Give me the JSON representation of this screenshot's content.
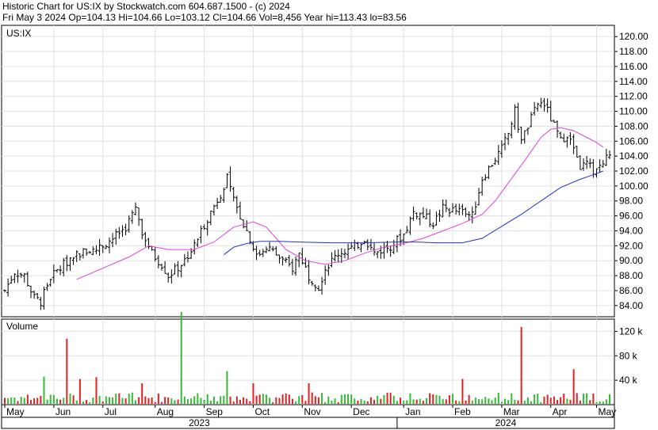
{
  "header": {
    "line1": "Historic Chart for US:IX by Stockwatch.com 604.687.1500 - (c) 2024",
    "line2": "Fri May  3 2024   Op=104.13   Hi=104.66   Lo=103.12   Cl=104.66   Vol=8,456   Year hi=113.43   lo=83.56"
  },
  "chart_data": {
    "type": "ohlc",
    "symbol_label": "US:IX",
    "volume_label": "Volume",
    "price_axis": {
      "ticks": [
        "120.00",
        "118.00",
        "116.00",
        "114.00",
        "112.00",
        "110.00",
        "108.00",
        "106.00",
        "104.00",
        "102.00",
        "100.00",
        "98.00",
        "96.00",
        "94.00",
        "92.00",
        "90.00",
        "88.00",
        "86.00",
        "84.00"
      ],
      "range": [
        82.5,
        121.5
      ]
    },
    "volume_axis": {
      "ticks": [
        "120 k",
        "80 k",
        "40 k"
      ],
      "range": [
        0,
        140000
      ]
    },
    "months": [
      "May",
      "Jun",
      "Jul",
      "Aug",
      "Sep",
      "Oct",
      "Nov",
      "Dec",
      "Jan",
      "Feb",
      "Mar",
      "Apr",
      "May"
    ],
    "years": [
      "2023",
      "2024"
    ],
    "price_anchors": [
      [
        0,
        86
      ],
      [
        3,
        88.5
      ],
      [
        6,
        88
      ],
      [
        9,
        85
      ],
      [
        11,
        84.5
      ],
      [
        14,
        87.8
      ],
      [
        18,
        89.5
      ],
      [
        22,
        91
      ],
      [
        28,
        91.5
      ],
      [
        33,
        93
      ],
      [
        37,
        94.5
      ],
      [
        40,
        97
      ],
      [
        42,
        94
      ],
      [
        45,
        91
      ],
      [
        48,
        89.5
      ],
      [
        50,
        88
      ],
      [
        54,
        89.5
      ],
      [
        58,
        92
      ],
      [
        60,
        94
      ],
      [
        63,
        96.5
      ],
      [
        66,
        99
      ],
      [
        68,
        101
      ],
      [
        70,
        98
      ],
      [
        72,
        96
      ],
      [
        75,
        93
      ],
      [
        77,
        90.5
      ],
      [
        80,
        92
      ],
      [
        85,
        90
      ],
      [
        88,
        89
      ],
      [
        90,
        91
      ],
      [
        93,
        88
      ],
      [
        96,
        86.5
      ],
      [
        98,
        89
      ],
      [
        102,
        91
      ],
      [
        107,
        91.8
      ],
      [
        110,
        93
      ],
      [
        113,
        91
      ],
      [
        118,
        92
      ],
      [
        122,
        93.5
      ],
      [
        125,
        96.5
      ],
      [
        128,
        96
      ],
      [
        131,
        95
      ],
      [
        134,
        97
      ],
      [
        140,
        96.5
      ],
      [
        143,
        96
      ],
      [
        146,
        101
      ],
      [
        149,
        103
      ],
      [
        152,
        105
      ],
      [
        154,
        107
      ],
      [
        156,
        110
      ],
      [
        158,
        106
      ],
      [
        160,
        108
      ],
      [
        163,
        111
      ],
      [
        165,
        111
      ],
      [
        167,
        109
      ],
      [
        170,
        106
      ],
      [
        172,
        107
      ],
      [
        174,
        105
      ],
      [
        176,
        102.5
      ],
      [
        178,
        103
      ],
      [
        180,
        102
      ],
      [
        183,
        103
      ],
      [
        185,
        104.5
      ]
    ],
    "volume_spikes": [
      [
        12,
        46000
      ],
      [
        19,
        108000
      ],
      [
        23,
        42000
      ],
      [
        28,
        45000
      ],
      [
        42,
        35000
      ],
      [
        54,
        152000
      ],
      [
        68,
        55000
      ],
      [
        76,
        35000
      ],
      [
        93,
        35000
      ],
      [
        140,
        42000
      ],
      [
        158,
        127000
      ],
      [
        174,
        58000
      ]
    ],
    "ma_short": [
      [
        22,
        87.5
      ],
      [
        30,
        89
      ],
      [
        38,
        90.5
      ],
      [
        44,
        92
      ],
      [
        50,
        91.5
      ],
      [
        58,
        91.5
      ],
      [
        64,
        92.5
      ],
      [
        70,
        94.5
      ],
      [
        76,
        95.2
      ],
      [
        80,
        94.5
      ],
      [
        86,
        91.5
      ],
      [
        92,
        90
      ],
      [
        98,
        89.5
      ],
      [
        104,
        90
      ],
      [
        110,
        91
      ],
      [
        116,
        91.8
      ],
      [
        122,
        92.3
      ],
      [
        128,
        93
      ],
      [
        134,
        94
      ],
      [
        140,
        95
      ],
      [
        146,
        96.2
      ],
      [
        150,
        98
      ],
      [
        155,
        101
      ],
      [
        160,
        104
      ],
      [
        164,
        106.5
      ],
      [
        167,
        107.6
      ],
      [
        170,
        107.8
      ],
      [
        174,
        107.4
      ],
      [
        178,
        106.5
      ],
      [
        181,
        105.8
      ],
      [
        183,
        105.2
      ]
    ],
    "ma_long": [
      [
        67,
        90.8
      ],
      [
        70,
        91.8
      ],
      [
        74,
        92.3
      ],
      [
        78,
        92.6
      ],
      [
        84,
        92.6
      ],
      [
        90,
        92.5
      ],
      [
        100,
        92.4
      ],
      [
        110,
        92.4
      ],
      [
        120,
        92.5
      ],
      [
        126,
        92.5
      ],
      [
        132,
        92.4
      ],
      [
        140,
        92.4
      ],
      [
        146,
        93
      ],
      [
        152,
        94.6
      ],
      [
        158,
        96.2
      ],
      [
        164,
        98
      ],
      [
        170,
        99.8
      ],
      [
        176,
        100.9
      ],
      [
        180,
        101.5
      ],
      [
        183,
        102
      ]
    ],
    "colors": {
      "ma_short": "#dd44dd",
      "ma_long": "#2233cc",
      "volume_up": "#33bb33",
      "volume_down": "#dd2222",
      "bars": "#000000"
    }
  }
}
